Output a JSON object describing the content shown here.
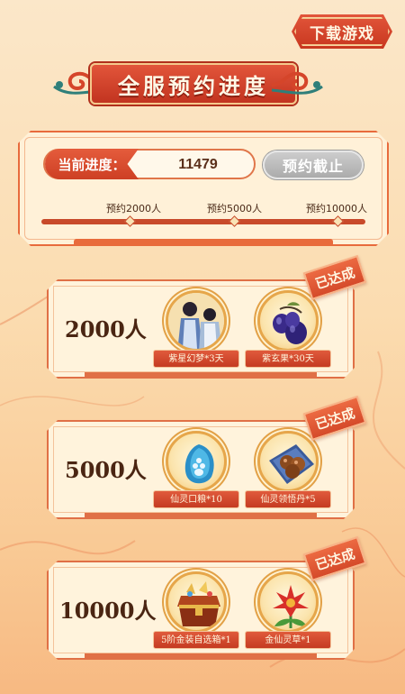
{
  "header": {
    "download_label": "下载游戏"
  },
  "banner": {
    "title": "全服预约进度"
  },
  "progress": {
    "label": "当前进度：",
    "value": "11479",
    "status_button": "预约截止",
    "milestones": [
      "预约2000人",
      "预约5000人",
      "预约10000人"
    ]
  },
  "tiers": [
    {
      "threshold": "2000人",
      "status": "已达成",
      "rewards": [
        {
          "name": "紫星幻梦*3天",
          "icon": "characters-icon"
        },
        {
          "name": "紫玄果*30天",
          "icon": "purple-fruit-icon"
        }
      ]
    },
    {
      "threshold": "5000人",
      "status": "已达成",
      "rewards": [
        {
          "name": "仙灵口粮*10",
          "icon": "spirit-food-icon"
        },
        {
          "name": "仙灵领悟丹*5",
          "icon": "pills-icon"
        }
      ]
    },
    {
      "threshold": "10000人",
      "status": "已达成",
      "rewards": [
        {
          "name": "5阶金装自选箱*1",
          "icon": "treasure-chest-icon"
        },
        {
          "name": "金仙灵草*1",
          "icon": "red-flower-icon"
        }
      ]
    }
  ],
  "colors": {
    "accent": "#d5452a",
    "panel": "#fff3dc",
    "gold": "#e6a64a",
    "disabled": "#b8b8b8"
  }
}
